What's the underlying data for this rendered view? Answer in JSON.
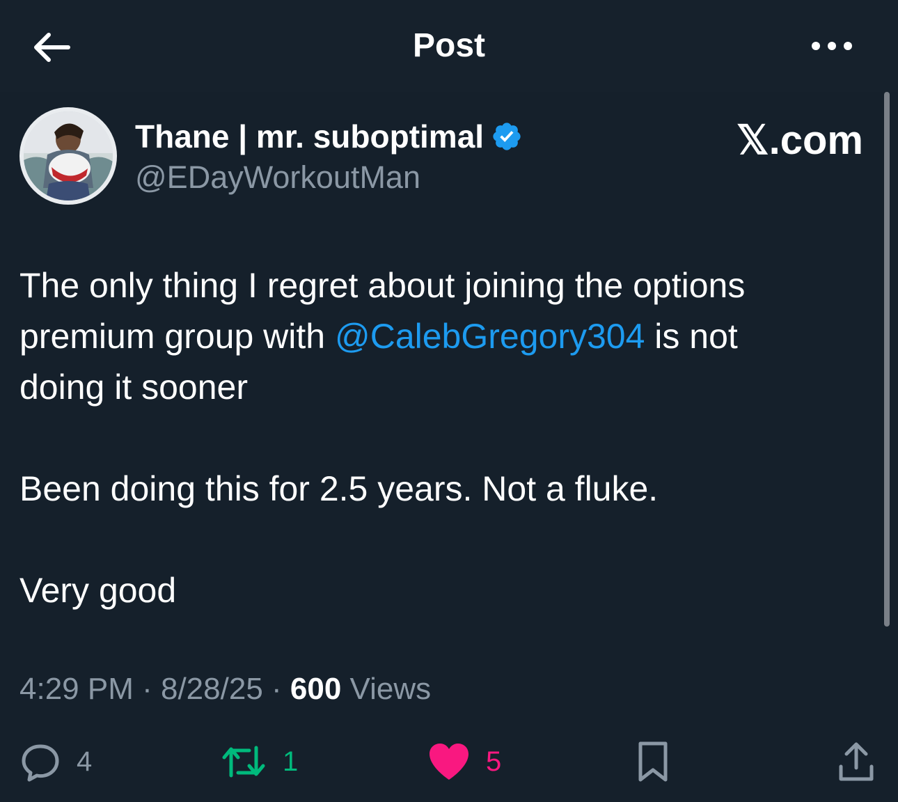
{
  "header": {
    "title": "Post",
    "back_icon": "arrow-left-icon",
    "more_icon": "more-horizontal-icon"
  },
  "author": {
    "name": "Thane | mr. suboptimal",
    "handle": "@EDayWorkoutMan",
    "verified": true,
    "verified_color": "#1d9bf0"
  },
  "source_label": "𝕏.com",
  "tweet": {
    "line1_text": "The only thing I regret about joining the options",
    "line2_before": "premium group with ",
    "mention": "@CalebGregory304",
    "line2_after": " is not",
    "line3_text": "doing it sooner",
    "paragraph2": "Been doing this for 2.5 years. Not a fluke.",
    "paragraph3": "Very good"
  },
  "meta": {
    "time": "4:29 PM",
    "separator": " · ",
    "date": "8/28/25",
    "views_count": "600",
    "views_label": " Views"
  },
  "actions": {
    "replies": "4",
    "retweets": "1",
    "likes": "5"
  },
  "colors": {
    "background": "#15202b",
    "accent": "#1d9bf0",
    "retweet": "#00ba7c",
    "like": "#f91880",
    "muted": "#8b98a5"
  }
}
